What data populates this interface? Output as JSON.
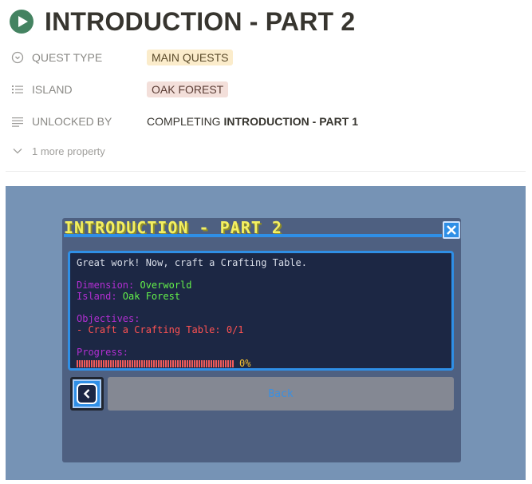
{
  "page": {
    "title": "INTRODUCTION - PART 2",
    "title_icon": "play-circle-icon"
  },
  "properties": [
    {
      "icon": "circle-chevron-icon",
      "label": "QUEST TYPE",
      "value": "MAIN QUESTS",
      "kind": "tag",
      "color": "#fbeccb"
    },
    {
      "icon": "list-icon",
      "label": "ISLAND",
      "value": "OAK FOREST",
      "kind": "tag",
      "color": "#f3dfda"
    },
    {
      "icon": "text-lines-icon",
      "label": "UNLOCKED BY",
      "value_prefix": "COMPLETING ",
      "value_bold": "INTRODUCTION - PART 1",
      "kind": "text"
    }
  ],
  "more_property": "1 more property",
  "game": {
    "quest_title": "INTRODUCTION - PART 2",
    "message": "Great work! Now, craft a Crafting Table.",
    "dimension_label": "Dimension: ",
    "dimension_value": "Overworld",
    "island_label": "Island: ",
    "island_value": "Oak Forest",
    "objectives_label": "Objectives:",
    "objective_item": "- Craft a Crafting Table: 0/1",
    "progress_label": "Progress:",
    "progress_percent": "0%",
    "progress_value": 0,
    "back_label": "Back",
    "colors": {
      "accent_blue": "#2f8fe6",
      "title_yellow": "#f4f061",
      "label_magenta": "#b22fd2",
      "value_green": "#63f04a",
      "objective_red": "#ff5252"
    }
  }
}
